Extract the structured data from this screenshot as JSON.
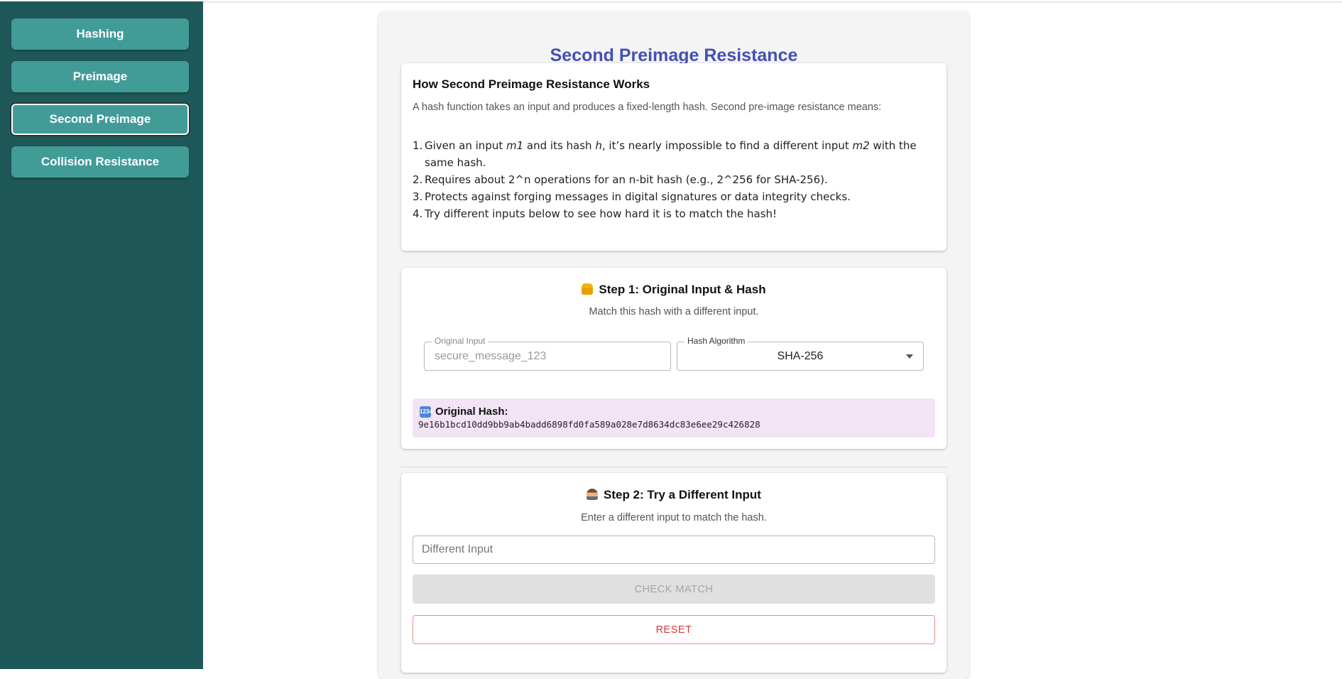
{
  "sidebar": {
    "items": [
      {
        "label": "Hashing"
      },
      {
        "label": "Preimage"
      },
      {
        "label": "Second Preimage"
      },
      {
        "label": "Collision Resistance"
      }
    ]
  },
  "main": {
    "title": "Second Preimage Resistance",
    "info": {
      "heading": "How Second Preimage Resistance Works",
      "intro": "A hash function takes an input and produces a fixed-length hash. Second pre-image resistance means:",
      "items": [
        {
          "num": "1.",
          "pre": "Given an input ",
          "m1": "m1",
          "mid1": " and its hash ",
          "h": "h",
          "mid2": ", it’s nearly impossible to find a different input ",
          "m2": "m2",
          "post": " with the same hash."
        },
        {
          "num": "2.",
          "text": "Requires about 2^n operations for an n-bit hash (e.g., 2^256 for SHA-256)."
        },
        {
          "num": "3.",
          "text": "Protects against forging messages in digital signatures or data integrity checks."
        },
        {
          "num": "4.",
          "text": "Try different inputs below to see how hard it is to match the hash!"
        }
      ]
    },
    "step1": {
      "icon": "lock-icon",
      "heading": "Step 1: Original Input & Hash",
      "subtitle": "Match this hash with a different input.",
      "original_input": {
        "label": "Original Input",
        "value": "secure_message_123"
      },
      "algorithm": {
        "label": "Hash Algorithm",
        "value": "SHA-256"
      },
      "hash": {
        "icon": "numbers-icon",
        "icon_text": "1234",
        "label": "Original Hash:",
        "value": "9e16b1bcd10dd9bb9ab4badd6898fd0fa589a028e7d8634dc83e6ee29c426828"
      }
    },
    "step2": {
      "icon": "detective-icon",
      "heading": "Step 2: Try a Different Input",
      "subtitle": "Enter a different input to match the hash.",
      "input_placeholder": "Different Input",
      "check_label": "CHECK MATCH",
      "reset_label": "RESET"
    }
  },
  "colors": {
    "sidebar_bg": "#1f5858",
    "nav_button": "#419c98",
    "title": "#4350b4",
    "hash_box": "#f2e4f4",
    "reset": "#d33a3a"
  }
}
